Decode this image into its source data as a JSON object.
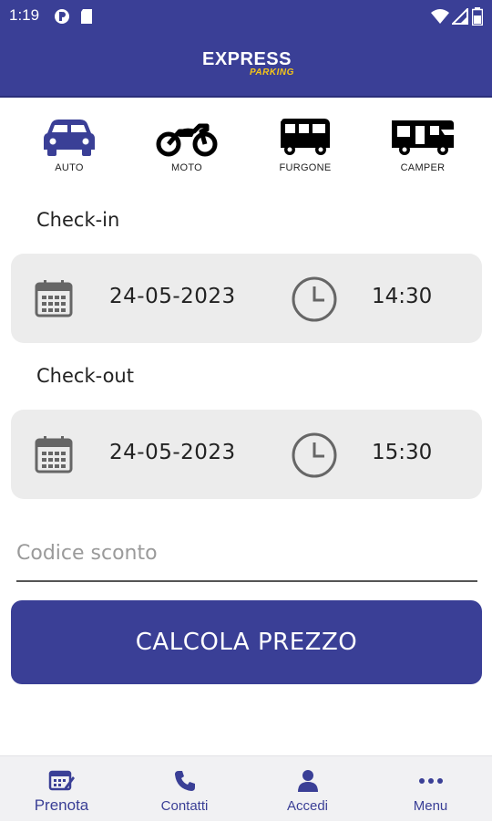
{
  "status_bar": {
    "time": "1:19"
  },
  "brand": {
    "logo_line1": "EXPRESS",
    "logo_line2": "PARKING"
  },
  "vehicles": [
    {
      "label": "AUTO",
      "icon": "car-icon",
      "selected": true
    },
    {
      "label": "MOTO",
      "icon": "motorcycle-icon",
      "selected": false
    },
    {
      "label": "FURGONE",
      "icon": "van-icon",
      "selected": false
    },
    {
      "label": "CAMPER",
      "icon": "camper-icon",
      "selected": false
    }
  ],
  "checkin": {
    "label": "Check-in",
    "date": "24-05-2023",
    "time": "14:30"
  },
  "checkout": {
    "label": "Check-out",
    "date": "24-05-2023",
    "time": "15:30"
  },
  "discount": {
    "placeholder": "Codice sconto",
    "value": ""
  },
  "cta": {
    "label": "CALCOLA PREZZO"
  },
  "bottom_nav": [
    {
      "label": "Prenota",
      "icon": "booking-icon",
      "active": true
    },
    {
      "label": "Contatti",
      "icon": "phone-icon",
      "active": false
    },
    {
      "label": "Accedi",
      "icon": "user-icon",
      "active": false
    },
    {
      "label": "Menu",
      "icon": "more-dots-icon",
      "active": false
    }
  ],
  "colors": {
    "primary": "#3a3f96",
    "accent": "#f5c518",
    "field_bg": "#ececec"
  }
}
